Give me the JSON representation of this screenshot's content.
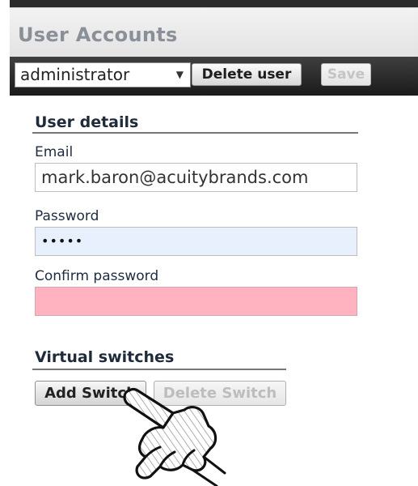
{
  "header": {
    "title": "User Accounts"
  },
  "toolbar": {
    "user_select": {
      "selected": "administrator",
      "arrow": "▼"
    },
    "delete_user_label": "Delete user",
    "save_label": "Save"
  },
  "user_details": {
    "heading": "User details",
    "email": {
      "label": "Email",
      "value": "mark.baron@acuitybrands.com"
    },
    "password": {
      "label": "Password",
      "value": "•••••"
    },
    "confirm_password": {
      "label": "Confirm password",
      "value": ""
    }
  },
  "virtual_switches": {
    "heading": "Virtual switches",
    "add_label": "Add Switch",
    "delete_label": "Delete Switch"
  },
  "icons": {
    "dropdown_arrow": "chevron-down-icon",
    "cursor": "pointing-hand-icon"
  },
  "colors": {
    "toolbar_bg": "#2b2b2b",
    "title_text": "#8a9097",
    "password_field_bg": "#e8f0fd",
    "confirm_field_invalid_bg": "#ffb3c1"
  }
}
